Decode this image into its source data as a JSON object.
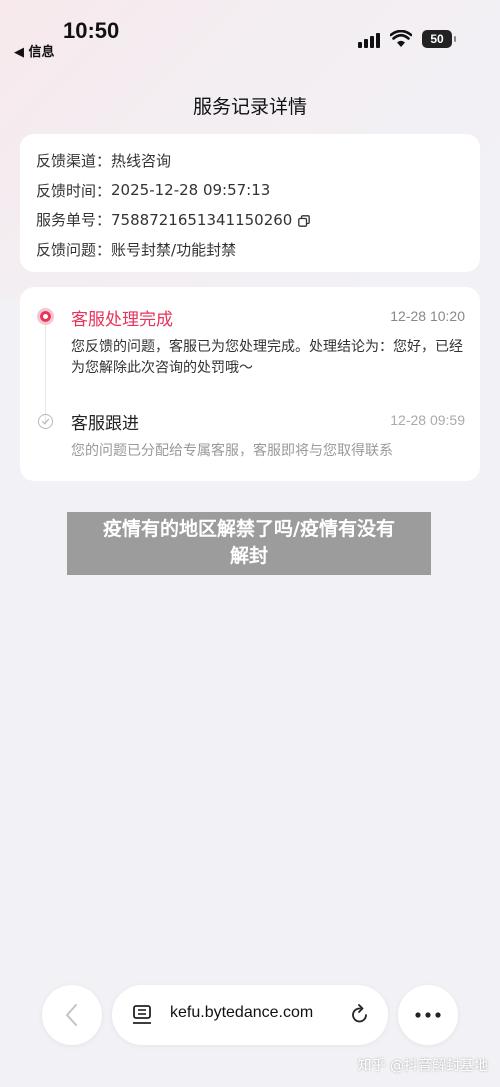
{
  "status_bar": {
    "time": "10:50",
    "back_app": "◀ 信息",
    "battery": "50"
  },
  "page": {
    "title": "服务记录详情"
  },
  "info": {
    "rows": [
      {
        "label": "反馈渠道：",
        "value": "热线咨询"
      },
      {
        "label": "反馈时间：",
        "value": "2025-12-28 09:57:13"
      },
      {
        "label": "服务单号：",
        "value": "7588721651341150260"
      },
      {
        "label": "反馈问题：",
        "value": "账号封禁/功能封禁"
      }
    ]
  },
  "timeline": {
    "steps": [
      {
        "title": "客服处理完成",
        "time": "12-28 10:20",
        "desc": "您反馈的问题，客服已为您处理完成。处理结论为：您好，已经为您解除此次咨询的处罚哦～",
        "active": true
      },
      {
        "title": "客服跟进",
        "time": "12-28 09:59",
        "desc": "您的问题已分配给专属客服，客服即将与您取得联系",
        "active": false
      }
    ]
  },
  "overlay": {
    "text_line1": "疫情有的地区解禁了吗/疫情有没有",
    "text_line2": "解封"
  },
  "browser": {
    "url": "kefu.bytedance.com"
  },
  "watermark": {
    "text": "知乎 @抖音解封基地"
  },
  "colors": {
    "accent": "#e8335a",
    "background": "#f2f2f6",
    "muted": "#999999"
  }
}
